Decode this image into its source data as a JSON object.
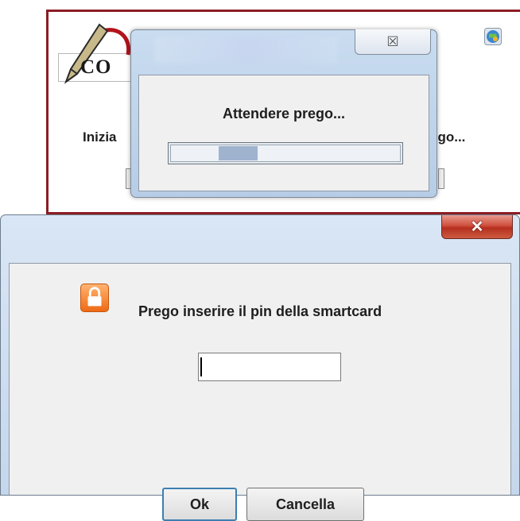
{
  "background_window": {
    "logo_text": "CO",
    "status_left": "Inizia",
    "status_right": "ego...",
    "corner_icon": "globe-icon"
  },
  "progress_dialog": {
    "close_glyph": "☒",
    "message": "Attendere prego...",
    "progress_indeterminate_position": 0.25
  },
  "pin_dialog": {
    "close_glyph": "✕",
    "icon": "lock-icon",
    "prompt": "Prego inserire il pin della smartcard",
    "pin_value": "",
    "ok_label": "Ok",
    "cancel_label": "Cancella"
  },
  "colors": {
    "frame_red": "#8c1c24",
    "close_red": "#c7402e",
    "lock_orange": "#f07b20",
    "progress_fill": "#9fb3cf"
  }
}
